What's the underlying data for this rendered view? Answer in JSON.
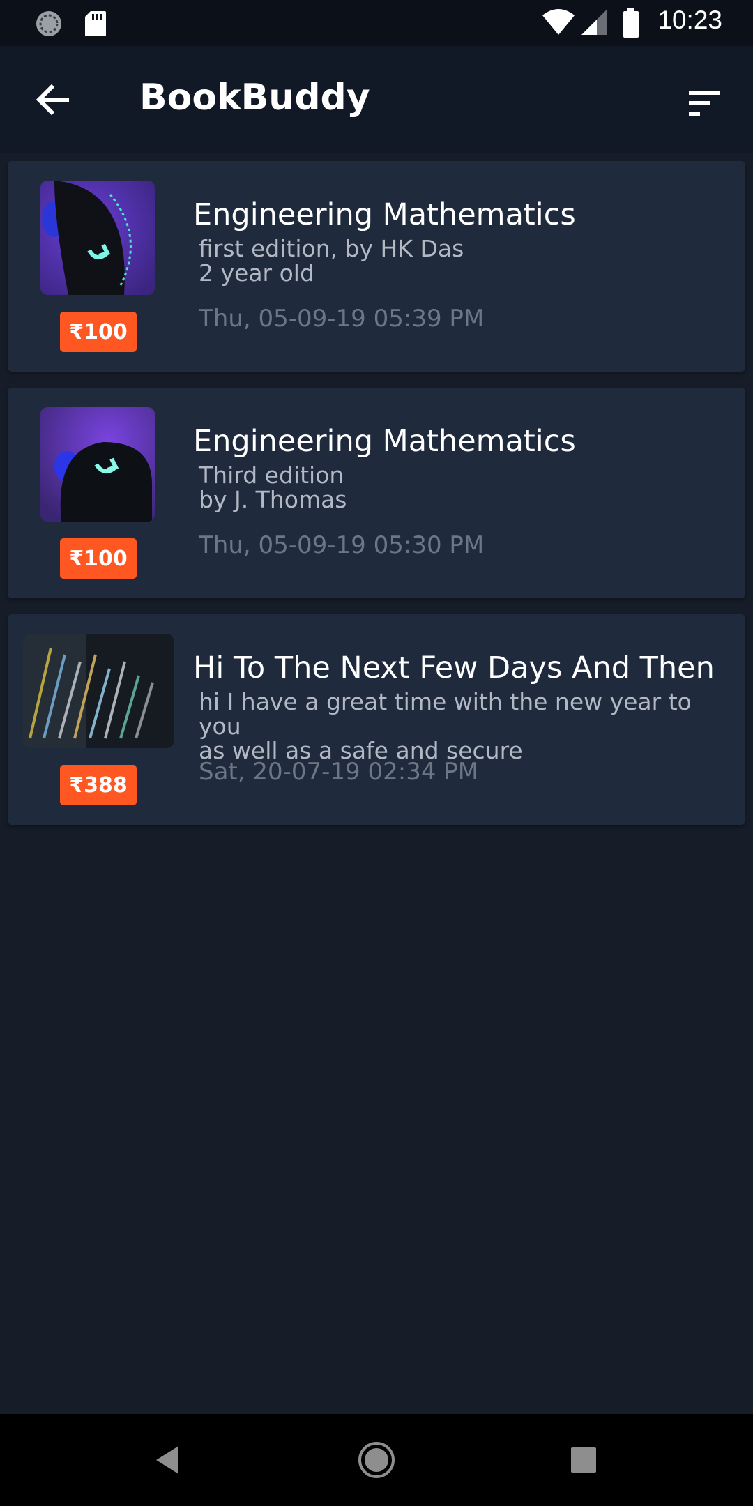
{
  "status_bar": {
    "time": "10:23",
    "left_icons": [
      "sync-icon",
      "sd-card-icon"
    ],
    "right_icons": [
      "wifi-icon",
      "signal-icon",
      "battery-icon"
    ]
  },
  "app_bar": {
    "title": "BookBuddy",
    "back_icon": "arrow-back-icon",
    "sort_icon": "sort-icon"
  },
  "books": [
    {
      "title": "Engineering Mathematics",
      "description": "first edition, by HK Das\n2 year old",
      "date": "Thu, 05-09-19 05:39 PM",
      "price": "₹100",
      "thumbnail": "mouse-photo"
    },
    {
      "title": "Engineering Mathematics",
      "description": "Third edition\nby J. Thomas",
      "date": "Thu, 05-09-19 05:30 PM",
      "price": "₹100",
      "thumbnail": "mouse-photo"
    },
    {
      "title": "Hi To The Next Few Days And Then",
      "description": "hi I have a great time with the new year to you\nas well as a safe and secure",
      "date": "Sat, 20-07-19 02:34 PM",
      "price": "₹388",
      "thumbnail": "code-screen-photo"
    }
  ],
  "colors": {
    "background": "#161d29",
    "card": "#1f2a3d",
    "app_bar": "#111826",
    "price_badge": "#ff5722"
  },
  "nav_bar": {
    "icons": [
      "back-triangle-icon",
      "home-circle-icon",
      "recents-square-icon"
    ]
  }
}
